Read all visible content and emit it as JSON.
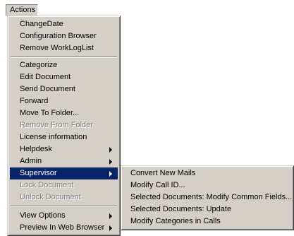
{
  "menubar": {
    "actions_label": "Actions"
  },
  "menu": {
    "group1": [
      "ChangeDate",
      "Configuration Browser",
      "Remove WorkLogList"
    ],
    "group2": [
      "Categorize",
      "Edit Document",
      "Send Document",
      "Forward",
      "Move To Folder...",
      "Remove From Folder",
      "License information",
      "Helpdesk",
      "Admin",
      "Supervisor",
      "Lock Document",
      "Unlock Document"
    ],
    "group3": [
      "View Options",
      "Preview In Web Browser"
    ]
  },
  "submenu": {
    "items": [
      "Convert New Mails",
      "Modify Call ID...",
      "Selected Documents: Modify Common Fields...",
      "Selected Documents: Update",
      "Modify Categories in Calls"
    ]
  },
  "colors": {
    "menu_bg": "#d4d0c8",
    "highlight": "#0a246a",
    "disabled_text": "#808080"
  }
}
